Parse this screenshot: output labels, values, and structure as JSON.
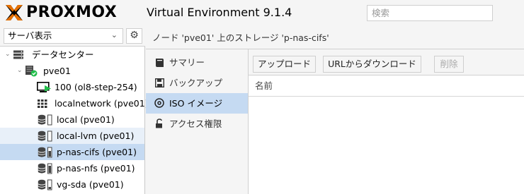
{
  "header": {
    "logo_text": "PROXMOX",
    "title": "Virtual Environment 9.1.4",
    "search_placeholder": "検索"
  },
  "sidebar": {
    "view_label": "サーバ表示",
    "tree": [
      {
        "label": "データセンター",
        "icon": "datacenter-icon"
      },
      {
        "label": "pve01",
        "icon": "node-online-icon"
      },
      {
        "label": "100 (ol8-step-254)",
        "icon": "vm-running-icon"
      },
      {
        "label": "localnetwork (pve01)",
        "icon": "network-grid-icon"
      },
      {
        "label": "local (pve01)",
        "icon": "storage-icon"
      },
      {
        "label": "local-lvm (pve01)",
        "icon": "storage-icon"
      },
      {
        "label": "p-nas-cifs (pve01)",
        "icon": "storage-icon"
      },
      {
        "label": "p-nas-nfs (pve01)",
        "icon": "storage-icon"
      },
      {
        "label": "vg-sda (pve01)",
        "icon": "storage-icon"
      }
    ]
  },
  "breadcrumb": "ノード 'pve01' 上のストレージ 'p-nas-cifs'",
  "nav": [
    {
      "label": "サマリー",
      "icon": "book-icon"
    },
    {
      "label": "バックアップ",
      "icon": "floppy-disk-icon"
    },
    {
      "label": "ISO イメージ",
      "icon": "disc-icon"
    },
    {
      "label": "アクセス権限",
      "icon": "unlock-icon"
    }
  ],
  "toolbar": {
    "upload": "アップロード",
    "download_url": "URLからダウンロード",
    "delete": "削除"
  },
  "grid": {
    "column_name": "名前"
  },
  "colors": {
    "logo_orange": "#e57000",
    "selection_blue": "#c5daf2",
    "status_green": "#21bf4b"
  }
}
